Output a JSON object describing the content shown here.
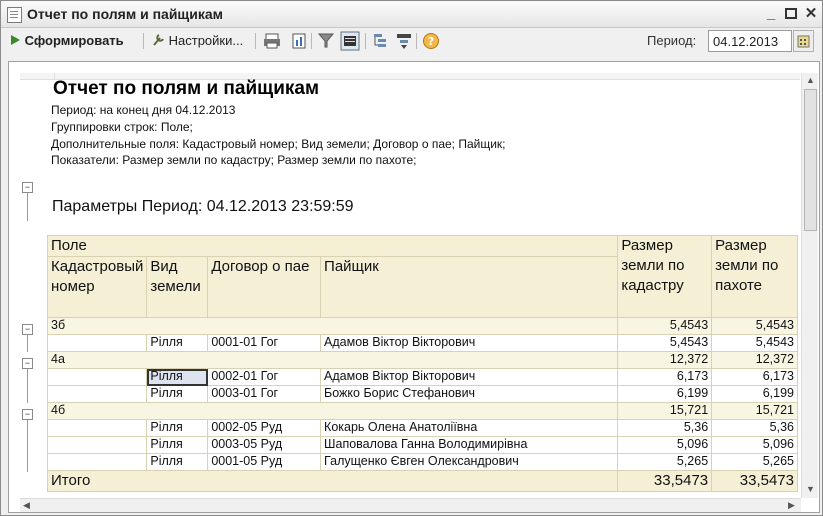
{
  "window": {
    "title": "Отчет по полям и пайщикам",
    "controls": [
      "minimize-icon",
      "maximize-icon",
      "close-icon"
    ]
  },
  "toolbar": {
    "generate_label": "Сформировать",
    "settings_label": "Настройки...",
    "period_label": "Период:",
    "period_value": "04.12.2013",
    "icons": [
      "play-icon",
      "wrench-icon",
      "print-icon",
      "report-icon",
      "filter-icon",
      "display-icon",
      "expand-icon",
      "collapse-icon",
      "help-icon",
      "calendar-icon"
    ]
  },
  "report": {
    "title": "Отчет по полям и пайщикам",
    "lines": [
      "Период: на конец дня 04.12.2013",
      "Группировки строк: Поле;",
      "Дополнительные поля: Кадастровый номер; Вид земели; Договор о пае; Пайщик;",
      "Показатели: Размер земли по кадастру; Размер земли по пахоте;"
    ],
    "params": "Параметры Период: 04.12.2013 23:59:59"
  },
  "table": {
    "headers": {
      "field": "Поле",
      "cadastral": "Кадастровый номер",
      "land_type": "Вид земели",
      "contract": "Договор о пае",
      "shareholder": "Пайщик",
      "size_cadastre": "Размер земли по кадастру",
      "size_arable": "Размер земли по пахоте"
    },
    "groups": [
      {
        "name": "3б",
        "cadastre": "5,4543",
        "arable": "5,4543",
        "rows": [
          {
            "type": "Рілля",
            "contract": "0001-01 Гог",
            "shareholder": "Адамов Віктор Вікторович",
            "cadastre": "5,4543",
            "arable": "5,4543"
          }
        ]
      },
      {
        "name": "4а",
        "cadastre": "12,372",
        "arable": "12,372",
        "rows": [
          {
            "type": "Рілля",
            "contract": "0002-01 Гог",
            "shareholder": "Адамов Віктор Вікторович",
            "cadastre": "6,173",
            "arable": "6,173"
          },
          {
            "type": "Рілля",
            "contract": "0003-01 Гог",
            "shareholder": "Божко Борис Стефанович",
            "cadastre": "6,199",
            "arable": "6,199"
          }
        ]
      },
      {
        "name": "4б",
        "cadastre": "15,721",
        "arable": "15,721",
        "rows": [
          {
            "type": "Рілля",
            "contract": "0002-05 Руд",
            "shareholder": "Кокарь Олена Анатоліївна",
            "cadastre": "5,36",
            "arable": "5,36"
          },
          {
            "type": "Рілля",
            "contract": "0003-05 Руд",
            "shareholder": "Шаповалова Ганна Володимирівна",
            "cadastre": "5,096",
            "arable": "5,096"
          },
          {
            "type": "Рілля",
            "contract": "0001-05 Руд",
            "shareholder": "Галущенко Євген Олександрович",
            "cadastre": "5,265",
            "arable": "5,265"
          }
        ]
      }
    ],
    "total": {
      "label": "Итого",
      "cadastre": "33,5473",
      "arable": "33,5473"
    }
  }
}
